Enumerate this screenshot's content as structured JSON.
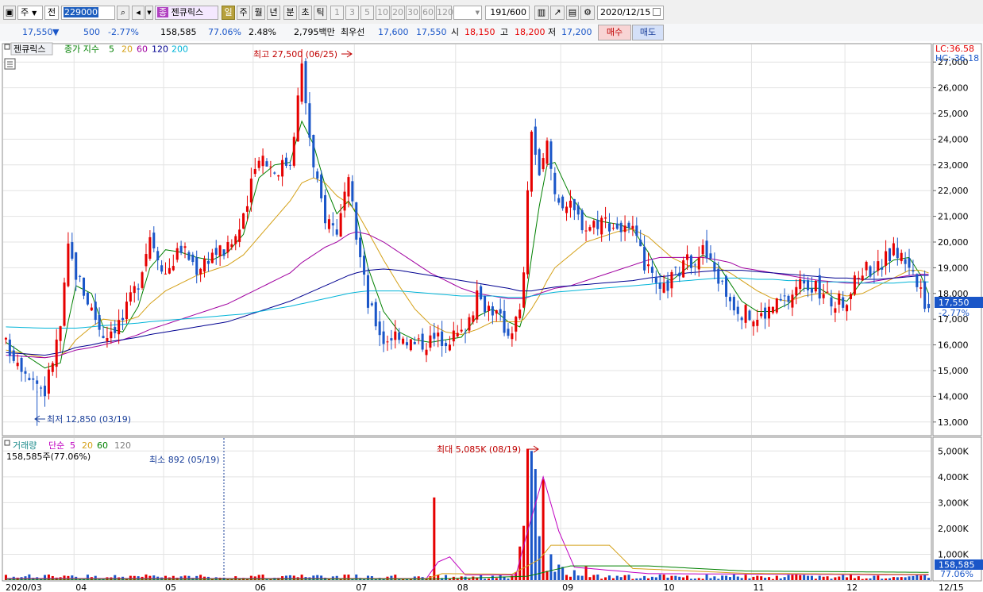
{
  "toolbar": {
    "market_label": "주",
    "compare_label": "전",
    "code": "229000",
    "search_icon": "magnifier-icon",
    "badge": "종",
    "stock_name": "젠큐릭스",
    "periods": [
      "일",
      "주",
      "월",
      "년",
      "분",
      "초",
      "틱"
    ],
    "selected_period": "일",
    "intervals": [
      "1",
      "3",
      "5",
      "10",
      "20",
      "30",
      "60",
      "120"
    ],
    "count": "191",
    "count_total": "/600",
    "date": "2020/12/15"
  },
  "quote": {
    "price": "17,550",
    "change_arrow": "▼",
    "change": "500",
    "change_rate": "-2.77%",
    "volume": "158,585",
    "volume_ratio": "77.06%",
    "turnover": "2.48%",
    "amount": "2,795백만",
    "best_label": "최우선",
    "ask": "17,600",
    "bid": "17,550",
    "open_label": "시",
    "open": "18,150",
    "high_label": "고",
    "high": "18,200",
    "low_label": "저",
    "low": "17,200",
    "buy_button": "매수",
    "sell_button": "매도"
  },
  "price_panel": {
    "name": "젠큐릭스",
    "legend_label": "종가 지수",
    "ma_periods": [
      "5",
      "20",
      "60",
      "120",
      "200"
    ],
    "ma_colors": [
      "#008000",
      "#d4a017",
      "#a000a0",
      "#000090",
      "#00b4d8"
    ],
    "high_note": "최고 27,500 (06/25)",
    "low_note": "최저 12,850 (03/19)",
    "lc": "LC:36.58",
    "hc": "HC:-36.18",
    "price_tag": "17,550",
    "rate_tag": "-2.77%"
  },
  "volume_panel": {
    "legend_label": "거래량",
    "legend_sub": "단순",
    "ma_periods": [
      "5",
      "20",
      "60",
      "120"
    ],
    "ma_colors": [
      "#c000c0",
      "#d4a017",
      "#008000",
      "#808080"
    ],
    "summary": "158,585주(77.06%)",
    "max_note": "최대 5,085K (08/19)",
    "min_note": "최소 892 (05/19)",
    "volume_tag": "158,585",
    "ratio_tag": "77.06%"
  },
  "x_axis": {
    "labels": [
      "2020/03",
      "04",
      "05",
      "06",
      "07",
      "08",
      "09",
      "10",
      "11",
      "12",
      "12/15"
    ]
  },
  "chart_data": [
    {
      "type": "candlestick",
      "title": "젠큐릭스",
      "ylim": [
        12500,
        27500
      ],
      "yticks": [
        "13,000",
        "14,000",
        "15,000",
        "16,000",
        "17,000",
        "18,000",
        "19,000",
        "20,000",
        "21,000",
        "22,000",
        "23,000",
        "24,000",
        "25,000",
        "26,000",
        "27,000"
      ],
      "ytick_values": [
        13000,
        14000,
        15000,
        16000,
        17000,
        18000,
        19000,
        20000,
        21000,
        22000,
        23000,
        24000,
        25000,
        26000,
        27000
      ],
      "grid": true,
      "up_color": "#e60000",
      "down_color": "#1a56c8",
      "anchors": [
        {
          "x": 0,
          "close": 16000,
          "ma5": 16100,
          "ma20": 15800,
          "ma60": 15600,
          "ma120": 15700,
          "ma200": 16700
        },
        {
          "x": 10,
          "close": 14200,
          "ma5": 15100,
          "ma20": 15500,
          "ma60": 15500,
          "ma120": 15600,
          "ma200": 16650
        },
        {
          "x": 14,
          "close": 16700,
          "ma5": 15300,
          "ma20": 15600,
          "ma60": 15600,
          "ma120": 15700,
          "ma200": 16650
        },
        {
          "x": 16,
          "close": 19700,
          "ma5": 16900,
          "ma20": 15800,
          "ma60": 15700,
          "ma120": 15800,
          "ma200": 16650
        },
        {
          "x": 18,
          "close": 18800,
          "ma5": 18300,
          "ma20": 16200,
          "ma60": 15800,
          "ma120": 15900,
          "ma200": 16650
        },
        {
          "x": 22,
          "close": 17400,
          "ma5": 18000,
          "ma20": 16700,
          "ma60": 15900,
          "ma120": 16000,
          "ma200": 16700
        },
        {
          "x": 25,
          "close": 16400,
          "ma5": 16700,
          "ma20": 17000,
          "ma60": 16000,
          "ma120": 16100,
          "ma200": 16750
        },
        {
          "x": 30,
          "close": 17000,
          "ma5": 16500,
          "ma20": 16900,
          "ma60": 16200,
          "ma120": 16200,
          "ma200": 16800
        },
        {
          "x": 34,
          "close": 18500,
          "ma5": 17500,
          "ma20": 17100,
          "ma60": 16400,
          "ma120": 16300,
          "ma200": 16850
        },
        {
          "x": 37,
          "close": 20300,
          "ma5": 19000,
          "ma20": 17600,
          "ma60": 16600,
          "ma120": 16400,
          "ma200": 16900
        },
        {
          "x": 41,
          "close": 18800,
          "ma5": 19700,
          "ma20": 18100,
          "ma60": 16800,
          "ma120": 16500,
          "ma200": 16950
        },
        {
          "x": 45,
          "close": 19800,
          "ma5": 19600,
          "ma20": 18400,
          "ma60": 17000,
          "ma120": 16600,
          "ma200": 17000
        },
        {
          "x": 49,
          "close": 19000,
          "ma5": 19400,
          "ma20": 18700,
          "ma60": 17200,
          "ma120": 16700,
          "ma200": 17050
        },
        {
          "x": 53,
          "close": 19600,
          "ma5": 19300,
          "ma20": 18900,
          "ma60": 17400,
          "ma120": 16800,
          "ma200": 17100
        },
        {
          "x": 57,
          "close": 19700,
          "ma5": 19600,
          "ma20": 19100,
          "ma60": 17600,
          "ma120": 16900,
          "ma200": 17150
        },
        {
          "x": 61,
          "close": 20800,
          "ma5": 20300,
          "ma20": 19500,
          "ma60": 17900,
          "ma120": 17100,
          "ma200": 17200
        },
        {
          "x": 65,
          "close": 23500,
          "ma5": 22500,
          "ma20": 20200,
          "ma60": 18200,
          "ma120": 17300,
          "ma200": 17300
        },
        {
          "x": 69,
          "close": 22800,
          "ma5": 23000,
          "ma20": 20900,
          "ma60": 18500,
          "ma120": 17500,
          "ma200": 17400
        },
        {
          "x": 73,
          "close": 23200,
          "ma5": 23100,
          "ma20": 21600,
          "ma60": 18800,
          "ma120": 17700,
          "ma200": 17500
        },
        {
          "x": 76,
          "close": 26800,
          "ma5": 24700,
          "ma20": 22300,
          "ma60": 19200,
          "ma120": 17900,
          "ma200": 17600
        },
        {
          "x": 79,
          "close": 22800,
          "ma5": 23800,
          "ma20": 22500,
          "ma60": 19500,
          "ma120": 18100,
          "ma200": 17700
        },
        {
          "x": 82,
          "close": 21000,
          "ma5": 22200,
          "ma20": 22300,
          "ma60": 19800,
          "ma120": 18300,
          "ma200": 17800
        },
        {
          "x": 85,
          "close": 20500,
          "ma5": 21100,
          "ma20": 21800,
          "ma60": 20000,
          "ma120": 18500,
          "ma200": 17900
        },
        {
          "x": 88,
          "close": 22200,
          "ma5": 21600,
          "ma20": 21500,
          "ma60": 20300,
          "ma120": 18700,
          "ma200": 18000
        },
        {
          "x": 90,
          "close": 20300,
          "ma5": 21100,
          "ma20": 21200,
          "ma60": 20400,
          "ma120": 18800,
          "ma200": 18050
        },
        {
          "x": 93,
          "close": 17600,
          "ma5": 19000,
          "ma20": 20400,
          "ma60": 20300,
          "ma120": 18900,
          "ma200": 18100
        },
        {
          "x": 97,
          "close": 16200,
          "ma5": 17300,
          "ma20": 19300,
          "ma60": 20000,
          "ma120": 18950,
          "ma200": 18100
        },
        {
          "x": 101,
          "close": 16500,
          "ma5": 16500,
          "ma20": 18300,
          "ma60": 19600,
          "ma120": 18900,
          "ma200": 18100
        },
        {
          "x": 105,
          "close": 16000,
          "ma5": 16200,
          "ma20": 17400,
          "ma60": 19200,
          "ma120": 18800,
          "ma200": 18050
        },
        {
          "x": 109,
          "close": 16200,
          "ma5": 16100,
          "ma20": 16800,
          "ma60": 18800,
          "ma120": 18700,
          "ma200": 18000
        },
        {
          "x": 113,
          "close": 16300,
          "ma5": 16200,
          "ma20": 16500,
          "ma60": 18500,
          "ma120": 18600,
          "ma200": 17950
        },
        {
          "x": 117,
          "close": 16400,
          "ma5": 16300,
          "ma20": 16400,
          "ma60": 18200,
          "ma120": 18500,
          "ma200": 17900
        },
        {
          "x": 121,
          "close": 17800,
          "ma5": 17100,
          "ma20": 16600,
          "ma60": 18000,
          "ma120": 18400,
          "ma200": 17900
        },
        {
          "x": 125,
          "close": 17400,
          "ma5": 17400,
          "ma20": 16900,
          "ma60": 17900,
          "ma120": 18300,
          "ma200": 17900
        },
        {
          "x": 129,
          "close": 16500,
          "ma5": 16900,
          "ma20": 16900,
          "ma60": 17800,
          "ma120": 18200,
          "ma200": 17850
        },
        {
          "x": 132,
          "close": 17200,
          "ma5": 16700,
          "ma20": 16900,
          "ma60": 17800,
          "ma120": 18100,
          "ma200": 17850
        },
        {
          "x": 133,
          "close": 19000,
          "ma5": 17200,
          "ma20": 17000,
          "ma60": 17800,
          "ma120": 18100,
          "ma200": 17850
        },
        {
          "x": 135,
          "close": 24500,
          "ma5": 19400,
          "ma20": 17400,
          "ma60": 17900,
          "ma120": 18100,
          "ma200": 17900
        },
        {
          "x": 137,
          "close": 22400,
          "ma5": 21400,
          "ma20": 17900,
          "ma60": 18000,
          "ma120": 18150,
          "ma200": 17950
        },
        {
          "x": 139,
          "close": 23800,
          "ma5": 23000,
          "ma20": 18500,
          "ma60": 18100,
          "ma120": 18200,
          "ma200": 18000
        },
        {
          "x": 141,
          "close": 21900,
          "ma5": 23100,
          "ma20": 19000,
          "ma60": 18200,
          "ma120": 18250,
          "ma200": 18050
        },
        {
          "x": 145,
          "close": 21300,
          "ma5": 21800,
          "ma20": 19500,
          "ma60": 18300,
          "ma120": 18300,
          "ma200": 18100
        },
        {
          "x": 149,
          "close": 20600,
          "ma5": 21000,
          "ma20": 20000,
          "ma60": 18500,
          "ma120": 18350,
          "ma200": 18150
        },
        {
          "x": 153,
          "close": 20900,
          "ma5": 20800,
          "ma20": 20200,
          "ma60": 18700,
          "ma120": 18400,
          "ma200": 18200
        },
        {
          "x": 157,
          "close": 20600,
          "ma5": 20700,
          "ma20": 20400,
          "ma60": 18900,
          "ma120": 18450,
          "ma200": 18250
        },
        {
          "x": 161,
          "close": 20300,
          "ma5": 20500,
          "ma20": 20500,
          "ma60": 19100,
          "ma120": 18500,
          "ma200": 18300
        },
        {
          "x": 165,
          "close": 18800,
          "ma5": 19600,
          "ma20": 20200,
          "ma60": 19300,
          "ma120": 18600,
          "ma200": 18350
        },
        {
          "x": 168,
          "close": 17900,
          "ma5": 18700,
          "ma20": 19800,
          "ma60": 19400,
          "ma120": 18650,
          "ma200": 18400
        },
        {
          "x": 171,
          "close": 18600,
          "ma5": 18500,
          "ma20": 19400,
          "ma60": 19400,
          "ma120": 18700,
          "ma200": 18450
        },
        {
          "x": 175,
          "close": 19200,
          "ma5": 19000,
          "ma20": 19100,
          "ma60": 19400,
          "ma120": 18800,
          "ma200": 18500
        },
        {
          "x": 179,
          "close": 19700,
          "ma5": 19500,
          "ma20": 19000,
          "ma60": 19400,
          "ma120": 18850,
          "ma200": 18550
        },
        {
          "x": 183,
          "close": 18600,
          "ma5": 19100,
          "ma20": 19000,
          "ma60": 19300,
          "ma120": 18900,
          "ma200": 18600
        },
        {
          "x": 186,
          "close": 17800,
          "ma5": 18400,
          "ma20": 18800,
          "ma60": 19200,
          "ma120": 18900,
          "ma200": 18600
        },
        {
          "x": 189,
          "close": 17300,
          "ma5": 17700,
          "ma20": 18500,
          "ma60": 19000,
          "ma120": 18900,
          "ma200": 18600
        },
        {
          "x": 193,
          "close": 17000,
          "ma5": 17300,
          "ma20": 18100,
          "ma60": 18900,
          "ma120": 18850,
          "ma200": 18550
        },
        {
          "x": 197,
          "close": 17500,
          "ma5": 17300,
          "ma20": 17800,
          "ma60": 18800,
          "ma120": 18800,
          "ma200": 18550
        },
        {
          "x": 201,
          "close": 17800,
          "ma5": 17600,
          "ma20": 17700,
          "ma60": 18700,
          "ma120": 18750,
          "ma200": 18500
        },
        {
          "x": 205,
          "close": 18600,
          "ma5": 18200,
          "ma20": 17900,
          "ma60": 18600,
          "ma120": 18700,
          "ma200": 18500
        },
        {
          "x": 209,
          "close": 18000,
          "ma5": 18200,
          "ma20": 18000,
          "ma60": 18500,
          "ma120": 18650,
          "ma200": 18450
        },
        {
          "x": 213,
          "close": 17600,
          "ma5": 17800,
          "ma20": 18000,
          "ma60": 18450,
          "ma120": 18600,
          "ma200": 18450
        },
        {
          "x": 216,
          "close": 17800,
          "ma5": 17700,
          "ma20": 17900,
          "ma60": 18400,
          "ma120": 18600,
          "ma200": 18450
        },
        {
          "x": 220,
          "close": 19000,
          "ma5": 18500,
          "ma20": 18000,
          "ma60": 18400,
          "ma120": 18550,
          "ma200": 18400
        },
        {
          "x": 224,
          "close": 19000,
          "ma5": 18900,
          "ma20": 18300,
          "ma60": 18500,
          "ma120": 18550,
          "ma200": 18400
        },
        {
          "x": 228,
          "close": 19700,
          "ma5": 19300,
          "ma20": 18600,
          "ma60": 18600,
          "ma120": 18600,
          "ma200": 18400
        },
        {
          "x": 232,
          "close": 19200,
          "ma5": 19400,
          "ma20": 18900,
          "ma60": 18700,
          "ma120": 18650,
          "ma200": 18450
        },
        {
          "x": 235,
          "close": 17900,
          "ma5": 18700,
          "ma20": 18900,
          "ma60": 18750,
          "ma120": 18700,
          "ma200": 18450
        },
        {
          "x": 237,
          "close": 17550,
          "ma5": 18000,
          "ma20": 18800,
          "ma60": 18750,
          "ma120": 18700,
          "ma200": 18450
        }
      ],
      "notes": [
        {
          "label": "최고 27,500 (06/25)",
          "value": 27500
        },
        {
          "label": "최저 12,850 (03/19)",
          "value": 12850
        }
      ]
    },
    {
      "type": "bar",
      "title": "거래량",
      "ylim": [
        0,
        5500
      ],
      "unit": "K",
      "yticks": [
        "1,000K",
        "2,000K",
        "3,000K",
        "4,000K",
        "5,000K"
      ],
      "ytick_values": [
        1000,
        2000,
        3000,
        4000,
        5000
      ],
      "spikes": [
        {
          "x": 110,
          "value": 3200,
          "up": true
        },
        {
          "x": 132,
          "value": 1300,
          "up": true
        },
        {
          "x": 133,
          "value": 2100,
          "up": true
        },
        {
          "x": 134,
          "value": 5085,
          "up": true
        },
        {
          "x": 135,
          "value": 5000,
          "up": false
        },
        {
          "x": 136,
          "value": 4300,
          "up": false
        },
        {
          "x": 137,
          "value": 1700,
          "up": false
        },
        {
          "x": 138,
          "value": 3900,
          "up": true
        },
        {
          "x": 140,
          "value": 1000,
          "up": false
        },
        {
          "x": 142,
          "value": 600,
          "up": false
        },
        {
          "x": 60,
          "value": 80,
          "up": true
        },
        {
          "x": 252,
          "value": 600,
          "up": true
        }
      ],
      "ma5_anchors": [
        {
          "x": 0,
          "value": 60
        },
        {
          "x": 108,
          "value": 60
        },
        {
          "x": 111,
          "value": 700
        },
        {
          "x": 114,
          "value": 900
        },
        {
          "x": 118,
          "value": 200
        },
        {
          "x": 131,
          "value": 200
        },
        {
          "x": 134,
          "value": 1900
        },
        {
          "x": 138,
          "value": 4000
        },
        {
          "x": 142,
          "value": 1900
        },
        {
          "x": 146,
          "value": 500
        },
        {
          "x": 165,
          "value": 250
        },
        {
          "x": 237,
          "value": 200
        }
      ],
      "ma20_anchors": [
        {
          "x": 0,
          "value": 40
        },
        {
          "x": 108,
          "value": 50
        },
        {
          "x": 112,
          "value": 250
        },
        {
          "x": 130,
          "value": 230
        },
        {
          "x": 137,
          "value": 800
        },
        {
          "x": 140,
          "value": 1350
        },
        {
          "x": 155,
          "value": 1350
        },
        {
          "x": 161,
          "value": 450
        },
        {
          "x": 190,
          "value": 260
        },
        {
          "x": 237,
          "value": 220
        }
      ],
      "ma60_anchors": [
        {
          "x": 0,
          "value": 30
        },
        {
          "x": 110,
          "value": 40
        },
        {
          "x": 134,
          "value": 150
        },
        {
          "x": 145,
          "value": 550
        },
        {
          "x": 165,
          "value": 550
        },
        {
          "x": 190,
          "value": 350
        },
        {
          "x": 237,
          "value": 300
        }
      ],
      "last_volume": "158,585"
    }
  ]
}
